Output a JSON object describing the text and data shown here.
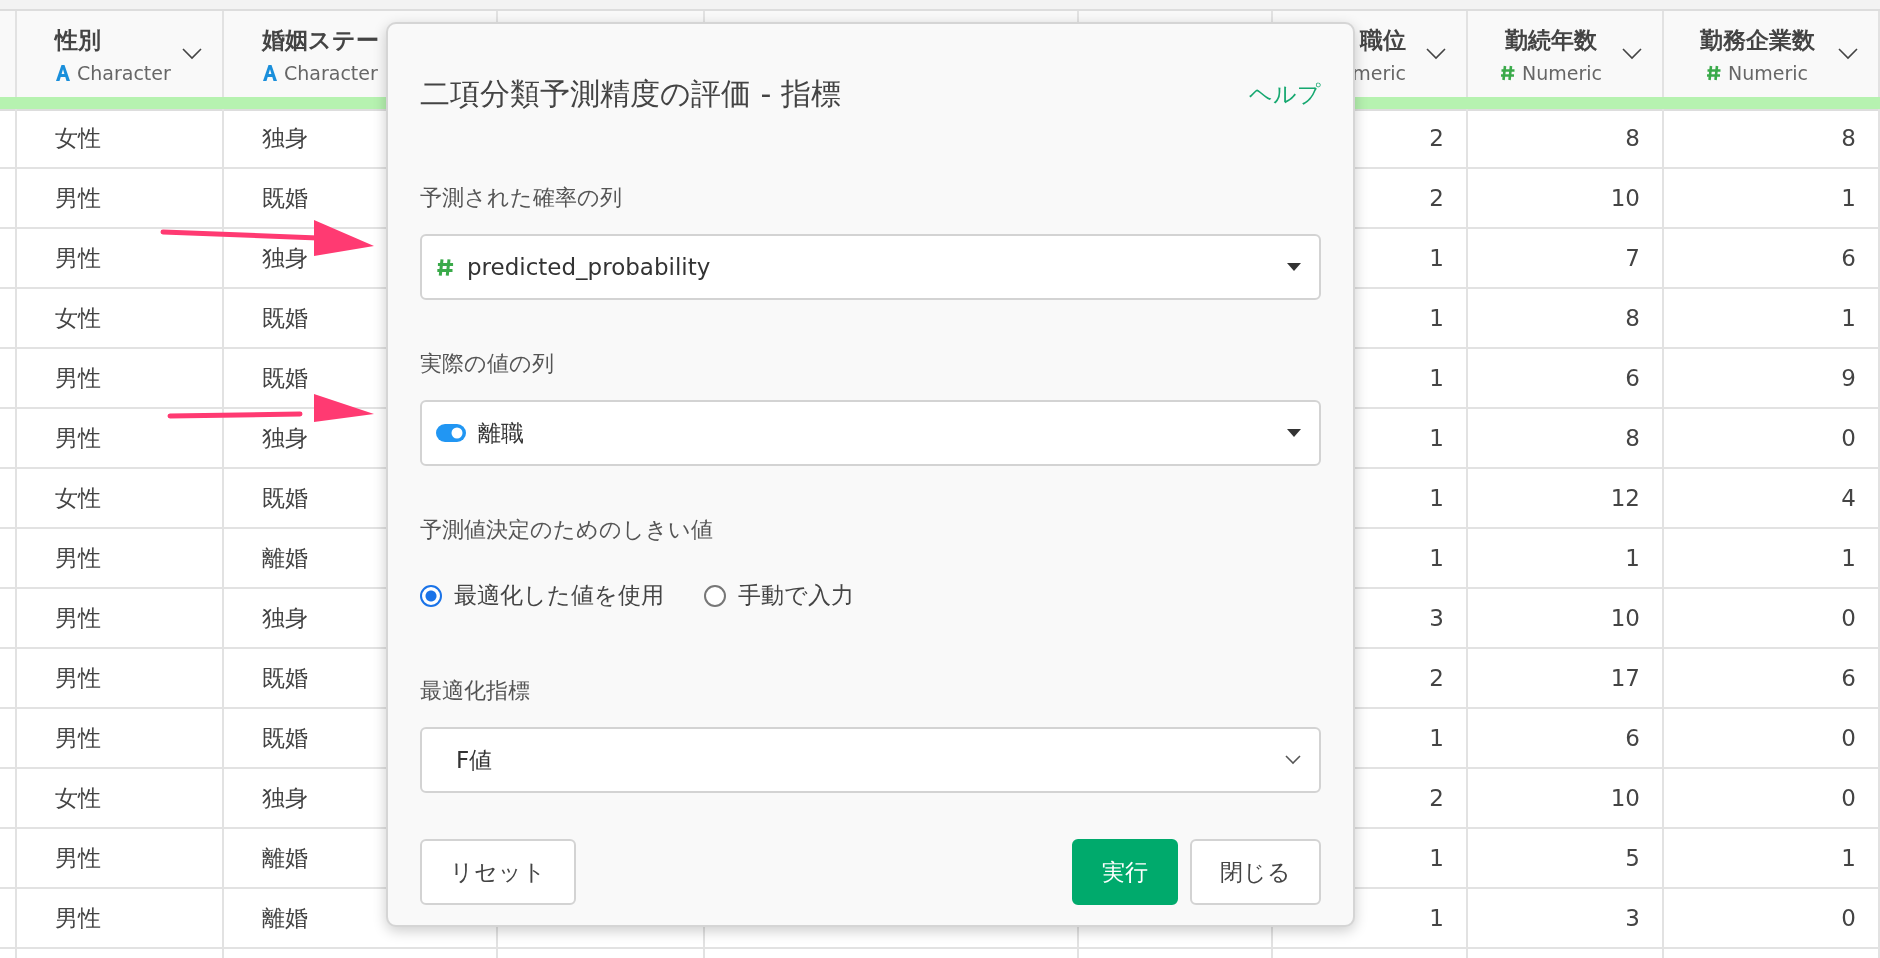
{
  "table": {
    "columns": [
      {
        "name": "性別",
        "type": "Character",
        "kind": "character"
      },
      {
        "name": "婚姻ステー",
        "type": "Character",
        "kind": "character"
      },
      {
        "name": "職位",
        "type": "meric",
        "kind": "numeric"
      },
      {
        "name": "勤続年数",
        "type": "Numeric",
        "kind": "numeric"
      },
      {
        "name": "勤務企業数",
        "type": "Numeric",
        "kind": "numeric"
      }
    ],
    "rows": [
      [
        "女性",
        "独身",
        "2",
        "8",
        "8"
      ],
      [
        "男性",
        "既婚",
        "2",
        "10",
        "1"
      ],
      [
        "男性",
        "独身",
        "1",
        "7",
        "6"
      ],
      [
        "女性",
        "既婚",
        "1",
        "8",
        "1"
      ],
      [
        "男性",
        "既婚",
        "1",
        "6",
        "9"
      ],
      [
        "男性",
        "独身",
        "1",
        "8",
        "0"
      ],
      [
        "女性",
        "既婚",
        "1",
        "12",
        "4"
      ],
      [
        "男性",
        "離婚",
        "1",
        "1",
        "1"
      ],
      [
        "男性",
        "独身",
        "3",
        "10",
        "0"
      ],
      [
        "男性",
        "既婚",
        "2",
        "17",
        "6"
      ],
      [
        "男性",
        "既婚",
        "1",
        "6",
        "0"
      ],
      [
        "女性",
        "独身",
        "2",
        "10",
        "0"
      ],
      [
        "男性",
        "離婚",
        "1",
        "5",
        "1"
      ],
      [
        "男性",
        "離婚",
        "1",
        "3",
        "0"
      ]
    ]
  },
  "dialog": {
    "title": "二項分類予測精度の評価 - 指標",
    "help_link": "ヘルプ",
    "fields": [
      {
        "kind": "numeric_select",
        "label": "予測された確率の列",
        "value": "predicted_probability"
      },
      {
        "kind": "toggle_select",
        "label": "実際の値の列",
        "value": "離職"
      },
      {
        "kind": "radio_group",
        "label": "予測値決定のためのしきい値",
        "options": [
          {
            "label": "最適化した値を使用",
            "selected": true
          },
          {
            "label": "手動で入力",
            "selected": false
          }
        ]
      },
      {
        "kind": "select",
        "label": "最適化指標",
        "value": "F値"
      }
    ],
    "buttons": [
      {
        "label": "リセット",
        "kind": "default"
      },
      {
        "label": "実行",
        "kind": "primary"
      },
      {
        "label": "閉じる",
        "kind": "default"
      }
    ]
  }
}
